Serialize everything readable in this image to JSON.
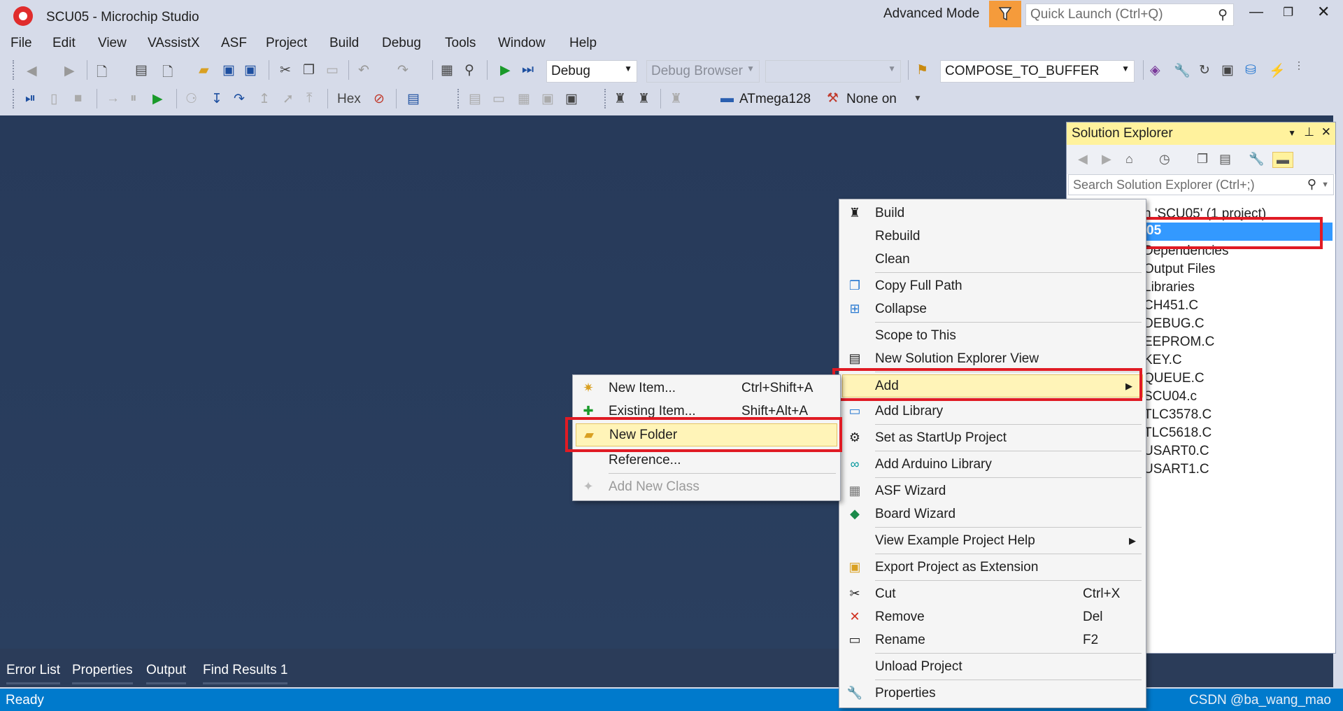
{
  "window": {
    "title": "SCU05 - Microchip Studio",
    "mode": "Advanced Mode",
    "quick_launch": "Quick Launch (Ctrl+Q)"
  },
  "menubar": [
    "File",
    "Edit",
    "View",
    "VAssistX",
    "ASF",
    "Project",
    "Build",
    "Debug",
    "Tools",
    "Window",
    "Help"
  ],
  "toolbar": {
    "config": "Debug",
    "debug_browser": "Debug Browser",
    "function": "COMPOSE_TO_BUFFER",
    "hex": "Hex",
    "device": "ATmega128",
    "tool": "None on"
  },
  "solution_explorer": {
    "title": "Solution Explorer",
    "search": "Search Solution Explorer (Ctrl+;)",
    "items": [
      "n 'SCU05' (1 project)",
      "05",
      "Dependencies",
      "Output Files",
      "Libraries",
      "CH451.C",
      "DEBUG.C",
      "EEPROM.C",
      "KEY.C",
      "QUEUE.C",
      "SCU04.c",
      "TLC3578.C",
      "TLC5618.C",
      "USART0.C",
      "USART1.C"
    ]
  },
  "context_menu": {
    "items": [
      {
        "label": "Build",
        "icon": "build-icon"
      },
      {
        "label": "Rebuild"
      },
      {
        "label": "Clean"
      },
      {
        "label": "Copy Full Path",
        "icon": "copy-path-icon"
      },
      {
        "label": "Collapse",
        "icon": "collapse-icon"
      },
      {
        "label": "Scope to This"
      },
      {
        "label": "New Solution Explorer View",
        "icon": "new-view-icon"
      },
      {
        "label": "Add",
        "submenu": true
      },
      {
        "label": "Add Library",
        "icon": "library-icon"
      },
      {
        "label": "Set as StartUp Project",
        "icon": "gear-icon"
      },
      {
        "label": "Add Arduino Library",
        "icon": "arduino-icon"
      },
      {
        "label": "ASF Wizard",
        "icon": "asf-icon"
      },
      {
        "label": "Board Wizard",
        "icon": "board-icon"
      },
      {
        "label": "View Example Project Help",
        "submenu": true
      },
      {
        "label": "Export Project as Extension",
        "icon": "export-icon"
      },
      {
        "label": "Cut",
        "key": "Ctrl+X",
        "icon": "scissors-icon"
      },
      {
        "label": "Remove",
        "key": "Del",
        "icon": "remove-icon"
      },
      {
        "label": "Rename",
        "key": "F2",
        "icon": "rename-icon"
      },
      {
        "label": "Unload Project"
      },
      {
        "label": "Properties",
        "icon": "wrench-icon"
      }
    ]
  },
  "submenu": {
    "items": [
      {
        "label": "New Item...",
        "key": "Ctrl+Shift+A"
      },
      {
        "label": "Existing Item...",
        "key": "Shift+Alt+A"
      },
      {
        "label": "New Folder",
        "key": ""
      },
      {
        "label": "Reference...",
        "key": ""
      },
      {
        "label": "Add New Class",
        "key": ""
      }
    ]
  },
  "bottom_tabs": [
    "Error List",
    "Properties",
    "Output",
    "Find Results 1"
  ],
  "status": {
    "text": "Ready",
    "watermark": "CSDN @ba_wang_mao"
  },
  "colors": {
    "accent": "#007acc",
    "highlight_box": "#e01b24",
    "selection": "#3399ff",
    "se_header": "#fff29d"
  }
}
